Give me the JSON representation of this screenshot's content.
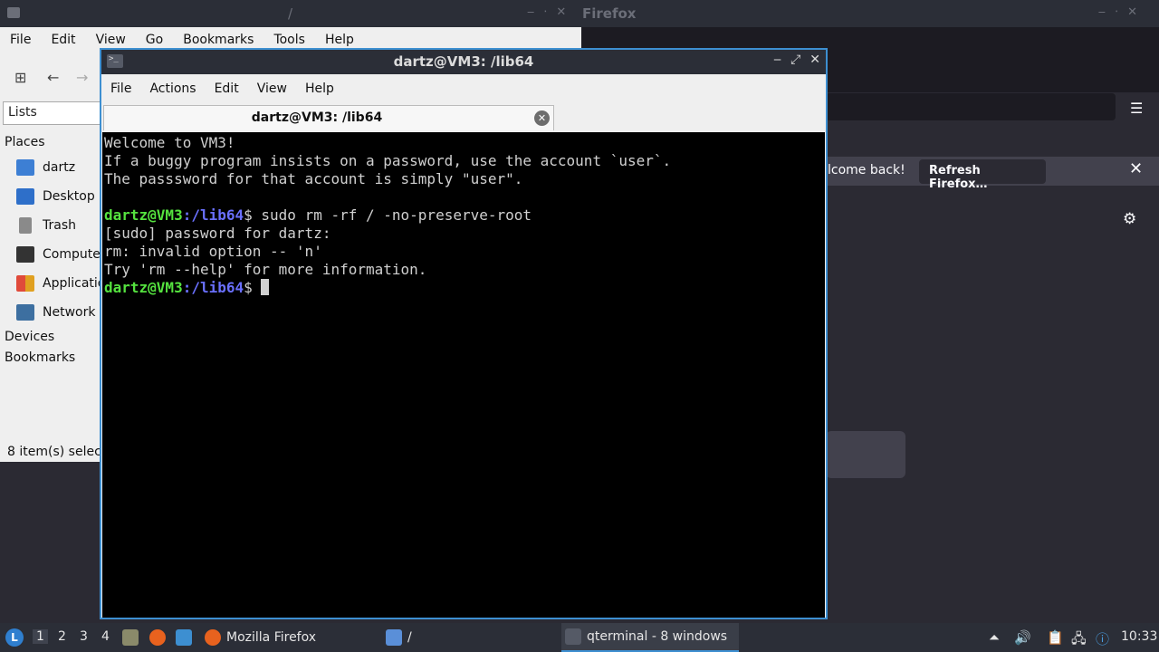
{
  "firefox": {
    "title": "Firefox",
    "notification_text": "lcome back!",
    "refresh_button": "Refresh Firefox…"
  },
  "file_manager": {
    "title": "/",
    "menu": [
      "File",
      "Edit",
      "View",
      "Go",
      "Bookmarks",
      "Tools",
      "Help"
    ],
    "lists_label": "Lists",
    "places_header": "Places",
    "places": [
      {
        "label": "dartz",
        "color": "#3d7fd4"
      },
      {
        "label": "Desktop",
        "color": "#2e6fc9"
      },
      {
        "label": "Trash",
        "color": "#8a8a8a"
      },
      {
        "label": "Compute",
        "color": "#333333"
      },
      {
        "label": "Applicatio",
        "color": "#e0a020"
      },
      {
        "label": "Network",
        "color": "#3d6fa0"
      }
    ],
    "devices_header": "Devices",
    "bookmarks_header": "Bookmarks",
    "status": "8 item(s) select"
  },
  "terminal": {
    "title": "dartz@VM3: /lib64",
    "menu": [
      "File",
      "Actions",
      "Edit",
      "View",
      "Help"
    ],
    "tab_label": "dartz@VM3: /lib64",
    "output": {
      "line1": "Welcome to VM3!",
      "line2": "If a buggy program insists on a password, use the account `user`.",
      "line3": "The passsword for that account is simply \"user\".",
      "prompt_user": "dartz@VM3",
      "prompt_path": ":/lib64",
      "prompt_sym": "$ ",
      "command": "sudo rm -rf / -no-preserve-root",
      "line5": "[sudo] password for dartz:",
      "line6": "rm: invalid option -- 'n'",
      "line7": "Try 'rm --help' for more information."
    }
  },
  "taskbar": {
    "desktops": [
      "1",
      "2",
      "3",
      "4"
    ],
    "tasks": {
      "firefox": "Mozilla Firefox",
      "files": "/",
      "terminal": "qterminal - 8 windows"
    },
    "clock": "10:33"
  }
}
